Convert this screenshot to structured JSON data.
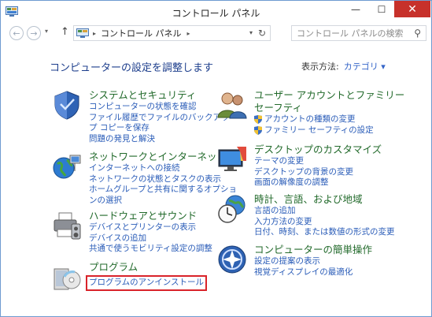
{
  "window": {
    "title": "コントロール パネル",
    "minimize": "—",
    "maximize": "☐",
    "close": "✕"
  },
  "nav": {
    "back": "←",
    "forward": "→",
    "dropdown": "▾",
    "up": "↑",
    "separator": "▸",
    "address": "コントロール パネル",
    "address_dropdown": "▾",
    "refresh": "↻"
  },
  "search": {
    "placeholder": "コントロール パネルの検索",
    "icon": "⚲"
  },
  "heading": "コンピューターの設定を調整します",
  "view_by": {
    "label": "表示方法:",
    "value": "カテゴリ ▾"
  },
  "categories": {
    "system": {
      "title": "システムとセキュリティ",
      "links": [
        "コンピューターの状態を確認",
        "ファイル履歴でファイルのバックアップ コピーを保存",
        "問題の発見と解決"
      ]
    },
    "network": {
      "title": "ネットワークとインターネット",
      "links": [
        "インターネットへの接続",
        "ネットワークの状態とタスクの表示",
        "ホームグループと共有に関するオプションの選択"
      ]
    },
    "hardware": {
      "title": "ハードウェアとサウンド",
      "links": [
        "デバイスとプリンターの表示",
        "デバイスの追加",
        "共通で使うモビリティ設定の調整"
      ]
    },
    "programs": {
      "title": "プログラム",
      "links": [
        "プログラムのアンインストール"
      ]
    },
    "users": {
      "title_line1": "ユーザー アカウントとファミリー",
      "title_line2": "セーフティ",
      "links": [
        "アカウントの種類の変更",
        "ファミリー セーフティの設定"
      ]
    },
    "appearance": {
      "title": "デスクトップのカスタマイズ",
      "links": [
        "テーマの変更",
        "デスクトップの背景の変更",
        "画面の解像度の調整"
      ]
    },
    "clock": {
      "title": "時計、言語、および地域",
      "links": [
        "言語の追加",
        "入力方法の変更",
        "日付、時刻、または数値の形式の変更"
      ]
    },
    "ease": {
      "title": "コンピューターの簡単操作",
      "links": [
        "設定の提案の表示",
        "視覚ディスプレイの最適化"
      ]
    }
  },
  "colors": {
    "heading": "#1d3e8c",
    "category_title": "#226a2b",
    "link": "#2a5cb8",
    "highlight": "#d9232a",
    "close": "#c7312b"
  }
}
